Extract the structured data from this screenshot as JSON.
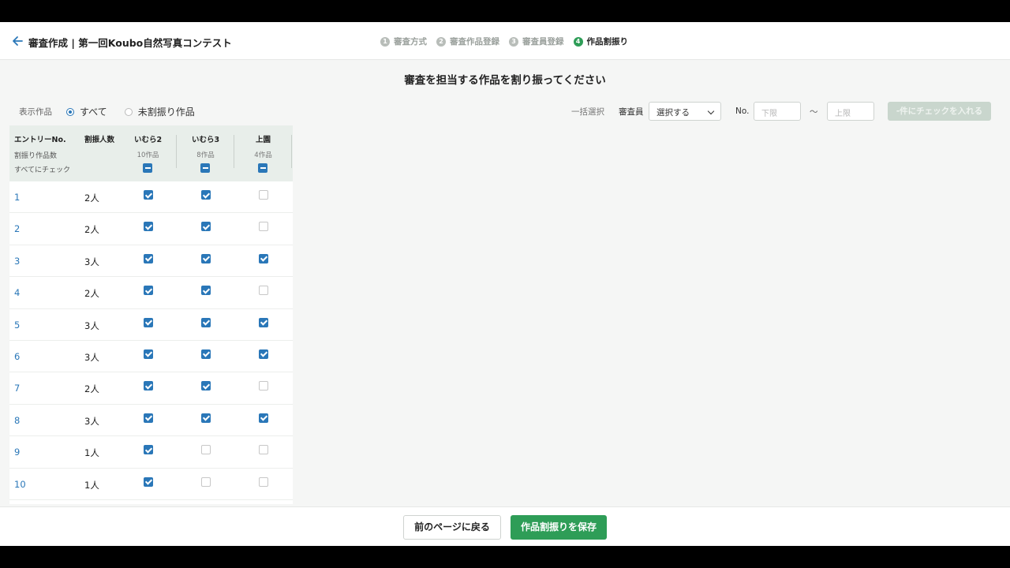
{
  "header": {
    "title": "審査作成 | 第一回Koubo自然写真コンテスト",
    "steps": [
      {
        "num": "1",
        "label": "審査方式",
        "active": false
      },
      {
        "num": "2",
        "label": "審査作品登録",
        "active": false
      },
      {
        "num": "3",
        "label": "審査員登録",
        "active": false
      },
      {
        "num": "4",
        "label": "作品割振り",
        "active": true
      }
    ]
  },
  "page_heading": "審査を担当する作品を割り振ってください",
  "filter": {
    "label": "表示作品",
    "options": [
      {
        "label": "すべて",
        "selected": true
      },
      {
        "label": "未割振り作品",
        "selected": false
      }
    ]
  },
  "bulk": {
    "label": "一括選択",
    "reviewer_label": "審査員",
    "reviewer_select": "選択する",
    "no_label": "No.",
    "lower_placeholder": "下限",
    "tilde": "〜",
    "upper_placeholder": "上限",
    "apply_button": "-件にチェックを入れる"
  },
  "table": {
    "headers": {
      "entry": "エントリーNo.",
      "count": "割振人数",
      "allocated": "割振り作品数",
      "check_all": "すべてにチェック"
    },
    "judges": [
      {
        "name": "いむら2",
        "works": "10作品"
      },
      {
        "name": "いむら3",
        "works": "8作品"
      },
      {
        "name": "上園",
        "works": "4作品"
      }
    ],
    "rows": [
      {
        "no": "1",
        "count": "2人",
        "checks": [
          true,
          true,
          false
        ]
      },
      {
        "no": "2",
        "count": "2人",
        "checks": [
          true,
          true,
          false
        ]
      },
      {
        "no": "3",
        "count": "3人",
        "checks": [
          true,
          true,
          true
        ]
      },
      {
        "no": "4",
        "count": "2人",
        "checks": [
          true,
          true,
          false
        ]
      },
      {
        "no": "5",
        "count": "3人",
        "checks": [
          true,
          true,
          true
        ]
      },
      {
        "no": "6",
        "count": "3人",
        "checks": [
          true,
          true,
          true
        ]
      },
      {
        "no": "7",
        "count": "2人",
        "checks": [
          true,
          true,
          false
        ]
      },
      {
        "no": "8",
        "count": "3人",
        "checks": [
          true,
          true,
          true
        ]
      },
      {
        "no": "9",
        "count": "1人",
        "checks": [
          true,
          false,
          false
        ]
      },
      {
        "no": "10",
        "count": "1人",
        "checks": [
          true,
          false,
          false
        ]
      }
    ]
  },
  "footer": {
    "back_button": "前のページに戻る",
    "save_button": "作品割振りを保存"
  },
  "colors": {
    "accent_green": "#2e9d57",
    "link_blue": "#2a77b8"
  }
}
